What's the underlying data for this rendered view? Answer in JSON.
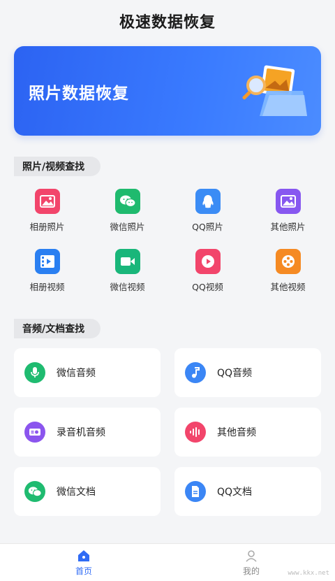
{
  "app": {
    "title": "极速数据恢复"
  },
  "banner": {
    "title": "照片数据恢复",
    "icon": "photo-folder-magnifier"
  },
  "sections": {
    "media": {
      "label": "照片/视频查找",
      "row1": [
        {
          "label": "相册照片",
          "icon": "image-icon",
          "color": "#f2456b"
        },
        {
          "label": "微信照片",
          "icon": "wechat-icon",
          "color": "#1fba6e"
        },
        {
          "label": "QQ照片",
          "icon": "qq-icon",
          "color": "#3b8cf5"
        },
        {
          "label": "其他照片",
          "icon": "image-icon",
          "color": "#8757f0"
        }
      ],
      "row2": [
        {
          "label": "相册视频",
          "icon": "film-icon",
          "color": "#2a7ff1"
        },
        {
          "label": "微信视频",
          "icon": "video-camera-icon",
          "color": "#19b67a"
        },
        {
          "label": "QQ视频",
          "icon": "play-icon",
          "color": "#f2456b"
        },
        {
          "label": "其他视频",
          "icon": "reel-icon",
          "color": "#f58a23"
        }
      ]
    },
    "docs": {
      "label": "音频/文档查找",
      "cards": [
        {
          "label": "微信音频",
          "icon": "microphone-icon",
          "color": "#1fbb70"
        },
        {
          "label": "QQ音频",
          "icon": "music-note-icon",
          "color": "#3b86f5"
        },
        {
          "label": "录音机音频",
          "icon": "recorder-icon",
          "color": "#8b55ee"
        },
        {
          "label": "其他音频",
          "icon": "waveform-icon",
          "color": "#f2456b"
        },
        {
          "label": "微信文档",
          "icon": "wechat-icon",
          "color": "#1fbb70"
        },
        {
          "label": "QQ文档",
          "icon": "document-icon",
          "color": "#3b86f5"
        }
      ]
    }
  },
  "tabbar": {
    "home": "首页",
    "mine": "我的",
    "active_color": "#2f6bf5"
  },
  "watermark": "www.kkx.net"
}
